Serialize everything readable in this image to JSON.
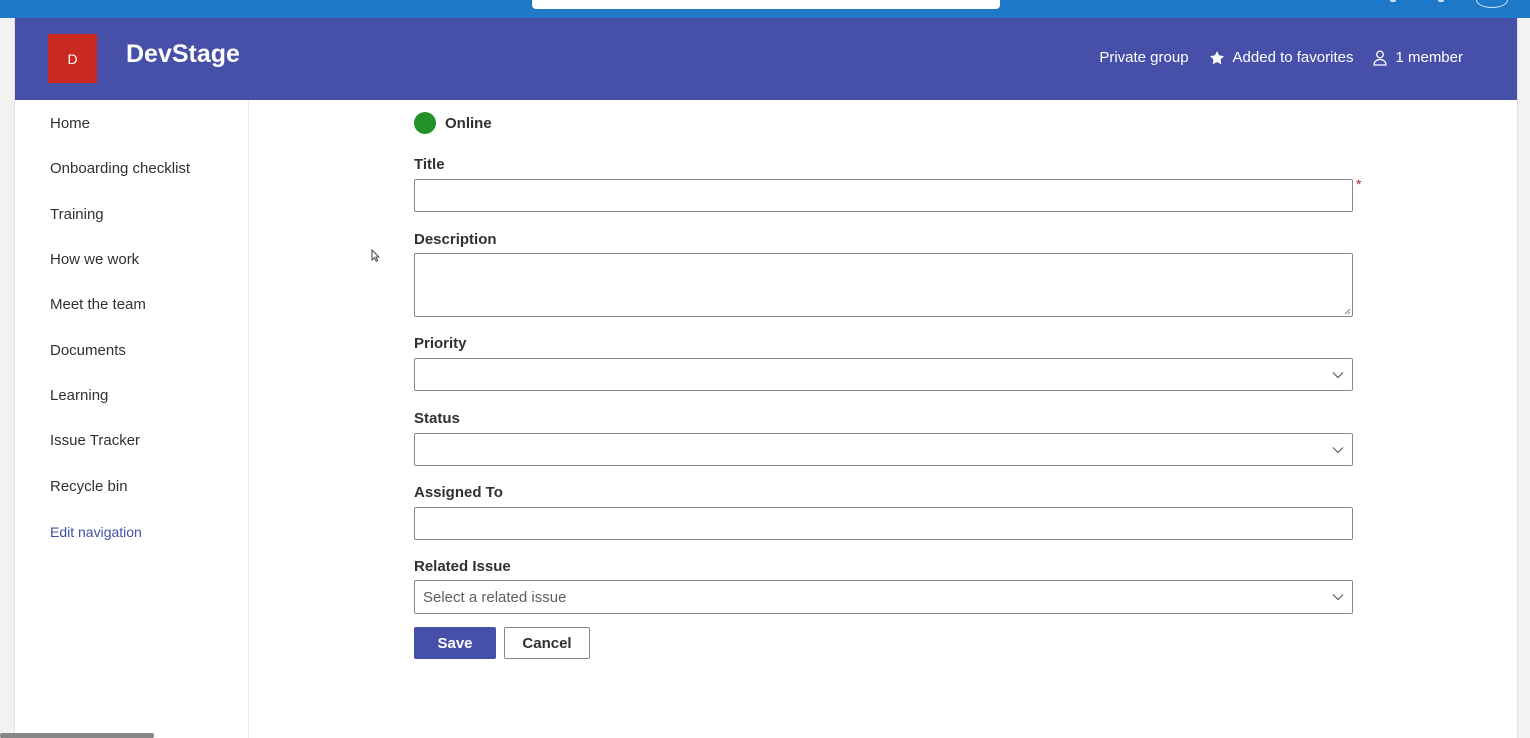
{
  "site": {
    "logo_letter": "D",
    "title": "DevStage",
    "privacy": "Private group",
    "favorite": "Added to favorites",
    "members": "1 member"
  },
  "nav": {
    "items": [
      {
        "label": "Home"
      },
      {
        "label": "Onboarding checklist"
      },
      {
        "label": "Training"
      },
      {
        "label": "How we work"
      },
      {
        "label": "Meet the team"
      },
      {
        "label": "Documents"
      },
      {
        "label": "Learning"
      },
      {
        "label": "Issue Tracker"
      },
      {
        "label": "Recycle bin"
      }
    ],
    "edit": "Edit navigation"
  },
  "form": {
    "status": "Online",
    "required_mark": "*",
    "fields": {
      "title": {
        "label": "Title",
        "value": ""
      },
      "description": {
        "label": "Description",
        "value": ""
      },
      "priority": {
        "label": "Priority",
        "value": ""
      },
      "status": {
        "label": "Status",
        "value": ""
      },
      "assigned_to": {
        "label": "Assigned To",
        "value": ""
      },
      "related_issue": {
        "label": "Related Issue",
        "placeholder": "Select a related issue"
      }
    },
    "save_label": "Save",
    "cancel_label": "Cancel"
  },
  "colors": {
    "suite_bar": "#1e79c8",
    "header": "#4650a8",
    "logo": "#c9291e",
    "online": "#22912a",
    "primary_button": "#4650a8",
    "required": "#a4262c"
  }
}
